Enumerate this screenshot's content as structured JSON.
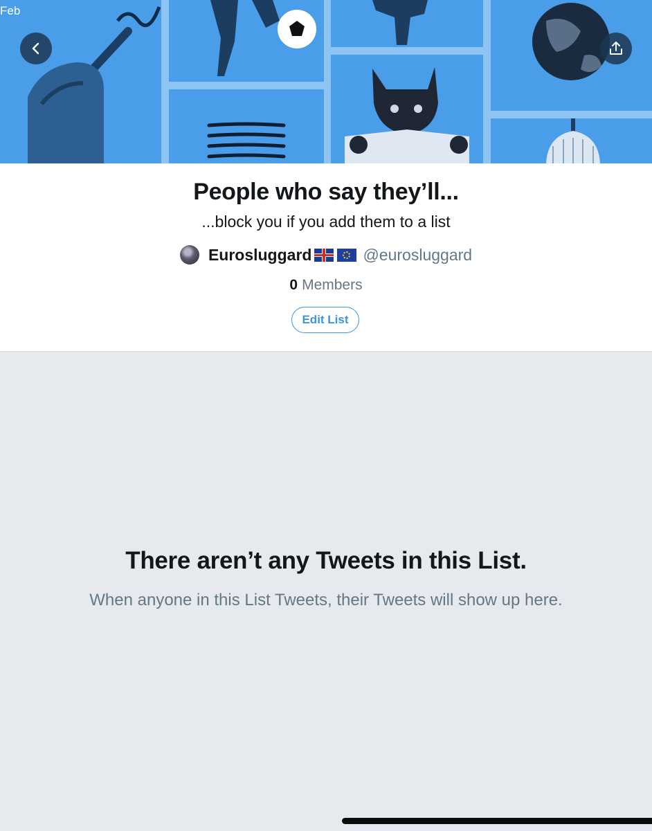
{
  "status_bar": {
    "time": "Feb"
  },
  "banner": {
    "back_icon": "chevron-left-icon",
    "share_icon": "share-icon"
  },
  "list": {
    "title": "People who say they’ll...",
    "description": "...block you if you add them to a list",
    "owner": {
      "name": "Eurosluggard",
      "flags": [
        "🇬🇧",
        "🇪🇺"
      ],
      "handle": "@eurosluggard"
    },
    "members_count": "0",
    "members_label": "Members",
    "edit_button": "Edit List"
  },
  "empty_state": {
    "title": "There aren’t any Tweets in this List.",
    "subtitle": "When anyone in this List Tweets, their Tweets will show up here."
  },
  "colors": {
    "banner_blue": "#4a9de9",
    "accent": "#3d95d8",
    "text_primary": "#14171a",
    "text_secondary": "#657786",
    "background": "#e6e9ee"
  }
}
